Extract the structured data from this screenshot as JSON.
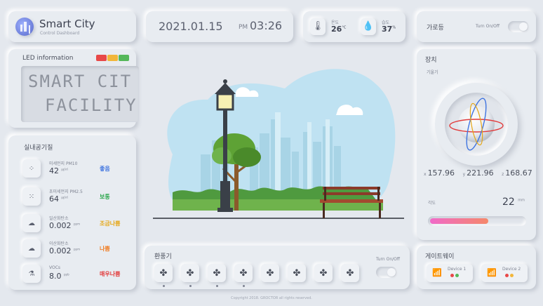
{
  "header": {
    "app_title": "Smart City",
    "app_subtitle": "Control Dashboard",
    "date": "2021.01.15",
    "ampm": "PM",
    "time": "03:26",
    "temperature": {
      "label": "온도",
      "value": "26",
      "unit": "°C"
    },
    "humidity": {
      "label": "습도",
      "value": "37",
      "unit": "%"
    },
    "streetlight": {
      "label": "가로등",
      "toggle_label": "Turn On/Off"
    }
  },
  "led": {
    "title": "LED information",
    "lamp_colors": [
      "#e84848",
      "#f2b63a",
      "#55b85a"
    ],
    "line1": "SMART CIT",
    "line2": "FACILITY"
  },
  "air": {
    "title": "실내공기질",
    "items": [
      {
        "name": "미세먼지 PM10",
        "value": "42",
        "unit": "㎍/㎥",
        "status": "좋음",
        "status_color": "#3f74e0",
        "icon": "dust-icon"
      },
      {
        "name": "초미세먼지 PM2.5",
        "value": "64",
        "unit": "㎍/㎥",
        "status": "보통",
        "status_color": "#2fa84f",
        "icon": "fine-dust-icon"
      },
      {
        "name": "일산화탄소",
        "value": "0.002",
        "unit": "ppm",
        "status": "조금나쁨",
        "status_color": "#e5a614",
        "icon": "co-icon"
      },
      {
        "name": "이산화탄소",
        "value": "0.002",
        "unit": "ppm",
        "status": "나쁨",
        "status_color": "#f07a1e",
        "icon": "co2-icon"
      },
      {
        "name": "VOCs",
        "value": "8.0",
        "unit": "ppb",
        "status": "매우나쁨",
        "status_color": "#e23b3b",
        "icon": "vocs-icon"
      }
    ]
  },
  "fan": {
    "title": "환풍기",
    "toggle_label": "Turn On/Off",
    "fans": [
      true,
      true,
      true,
      true,
      false,
      false,
      false,
      false
    ]
  },
  "device": {
    "title": "장치",
    "sub": "기울기",
    "x_label": "x",
    "x": "157.96",
    "y_label": "y",
    "y": "221.96",
    "z_label": "z",
    "z": "168.67",
    "angle_label": "각도",
    "angle": "22",
    "angle_unit": "mm",
    "progress": 0.62
  },
  "gateway": {
    "title": "게이트웨이",
    "devices": [
      {
        "name": "Device 1",
        "dots": [
          "#e84848",
          "#55b85a"
        ]
      },
      {
        "name": "Device 2",
        "dots": [
          "#e84848",
          "#f2b63a"
        ]
      }
    ]
  },
  "footer": {
    "copyright": "Copyright 2018. GROCTOR all rights reserved."
  }
}
